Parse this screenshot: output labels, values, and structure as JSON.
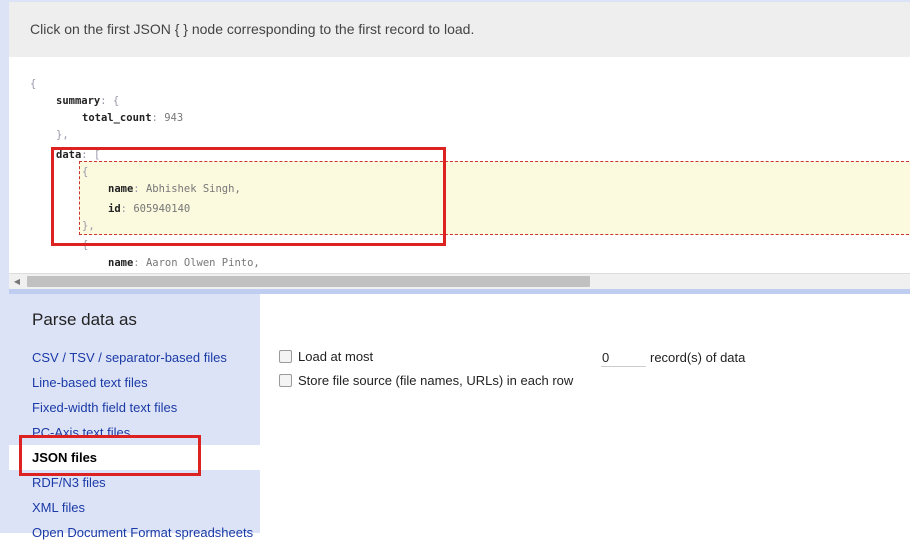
{
  "instruction": "Click on the first JSON { } node corresponding to the first record to load.",
  "json_preview": {
    "lines": [
      {
        "indent": 0,
        "punct": "{"
      },
      {
        "indent": 1,
        "key": "summary",
        "punct": ": {"
      },
      {
        "indent": 2,
        "key": "total_count",
        "sep": ": ",
        "value": "943"
      },
      {
        "indent": 1,
        "punct": "},"
      },
      {
        "indent": 1,
        "key": "data",
        "punct": ": ["
      },
      {
        "indent": 2,
        "punct": "{"
      },
      {
        "indent": 3,
        "key": "name",
        "sep": ": ",
        "value": "Abhishek Singh,"
      },
      {
        "indent": 3,
        "key": "id",
        "sep": ": ",
        "value": "605940140"
      },
      {
        "indent": 2,
        "punct": "},"
      },
      {
        "indent": 2,
        "punct": "{"
      },
      {
        "indent": 3,
        "key": "name",
        "sep": ": ",
        "value": "Aaron Olwen Pinto,"
      }
    ]
  },
  "sidebar": {
    "title": "Parse data as",
    "items": [
      {
        "label": "CSV / TSV / separator-based files",
        "selected": false
      },
      {
        "label": "Line-based text files",
        "selected": false
      },
      {
        "label": "Fixed-width field text files",
        "selected": false
      },
      {
        "label": "PC-Axis text files",
        "selected": false
      },
      {
        "label": "JSON files",
        "selected": true
      },
      {
        "label": "RDF/N3 files",
        "selected": false
      },
      {
        "label": "XML files",
        "selected": false
      },
      {
        "label": "Open Document Format spreadsheets",
        "selected": false
      }
    ]
  },
  "options": {
    "load_at_most_label": "Load at most",
    "load_at_most_value": "0",
    "records_suffix": "record(s) of data",
    "store_source_label": "Store file source (file names, URLs) in each row"
  },
  "colors": {
    "accent_link": "#1a3aa6",
    "callout_red": "#dd2222",
    "highlight_yellow": "#fbf9de",
    "sidebar_bg": "#dde3f7"
  }
}
